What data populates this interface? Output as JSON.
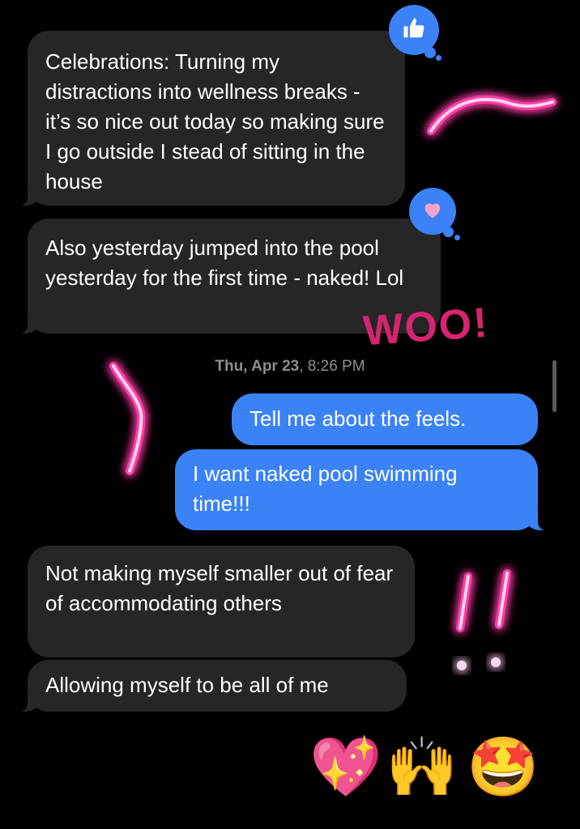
{
  "messages": {
    "m1": "Celebrations: Turning my distractions into wellness breaks - it’s so nice out today so making sure I go outside I stead of sitting in the house",
    "m2": "Also yesterday jumped into the pool yesterday for the first time - naked! Lol",
    "m3": "Tell me about the feels.",
    "m4": "I want naked pool swimming time!!!",
    "m5": "Not making myself smaller out of fear of accommodating others",
    "m6": "Allowing myself to be all of me"
  },
  "timestamp": {
    "day": "Thu, Apr 23",
    "time": "8:26 PM"
  },
  "tapbacks": {
    "m1": "thumbs-up-icon",
    "m2": "heart-icon"
  },
  "handwriting": {
    "woo": "WOO!",
    "exclaim": "!!"
  },
  "emoji_row": [
    "💖",
    "🙌",
    "🤩"
  ],
  "colors": {
    "outgoing": "#3b82f6",
    "incoming": "#262628",
    "neon": "#ff3ea5",
    "woo": "#d6246e"
  }
}
